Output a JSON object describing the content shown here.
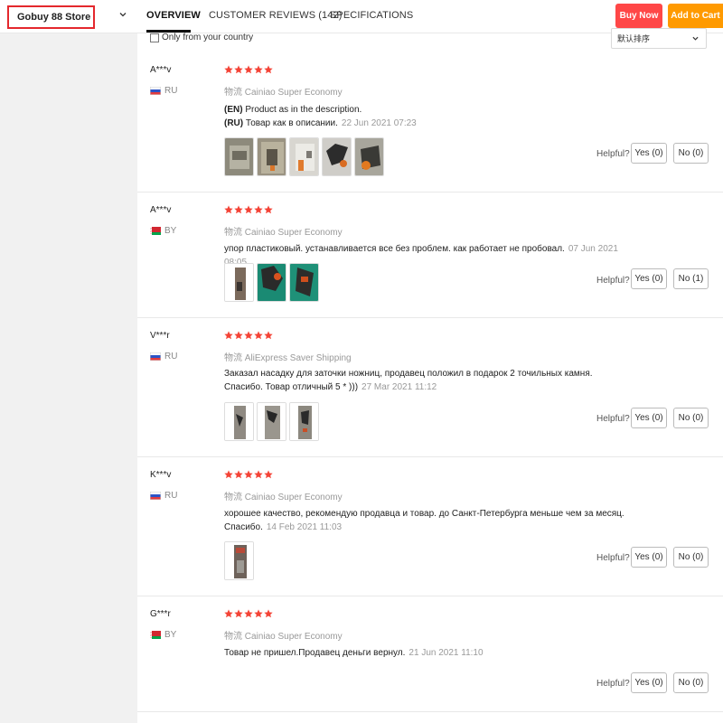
{
  "header": {
    "store_name": "Gobuy 88 Store",
    "tabs": [
      {
        "label": "OVERVIEW",
        "active": true
      },
      {
        "label": "CUSTOMER REVIEWS (142)",
        "active": false
      },
      {
        "label": "SPECIFICATIONS",
        "active": false
      }
    ],
    "buy_now_label": "Buy Now",
    "add_to_cart_label": "Add to Cart"
  },
  "filters": {
    "only_country_label": "Only from your country",
    "only_country_checked": false,
    "sort_value": "默认排序"
  },
  "helpful_label": "Helpful?",
  "reviews": [
    {
      "name": "A***v",
      "country": "RU",
      "flag": "russia-flag",
      "stars": 5,
      "shipping": "物流 Cainiao Super Economy",
      "text_en_prefix": "(EN)",
      "text_en": "Product as in the description.",
      "text_ru_prefix": "(RU)",
      "text_ru": "Товар как в описании.",
      "date": "22 Jun 2021 07:23",
      "photos": 5,
      "yes_label": "Yes (0)",
      "no_label": "No (0)"
    },
    {
      "name": "A***v",
      "country": "BY",
      "flag": "belarus-flag",
      "stars": 5,
      "shipping": "物流 Cainiao Super Economy",
      "text": "упор пластиковый. устанавливается все без проблем. как работает не пробовал.",
      "date": "07 Jun 2021 08:05",
      "photos": 3,
      "yes_label": "Yes (0)",
      "no_label": "No (1)"
    },
    {
      "name": "V***r",
      "country": "RU",
      "flag": "russia-flag",
      "stars": 5,
      "shipping": "物流 AliExpress Saver Shipping",
      "text": "Заказал насадку для заточки ножниц, продавец положил в подарок 2 точильных камня. Спасибо. Товар отличный 5 * )))",
      "date": "27 Mar 2021 11:12",
      "photos": 3,
      "yes_label": "Yes (0)",
      "no_label": "No (0)"
    },
    {
      "name": "K***v",
      "country": "RU",
      "flag": "russia-flag",
      "stars": 5,
      "shipping": "物流 Cainiao Super Economy",
      "text": "хорошее качество, рекомендую продавца и товар. до Санкт-Петербурга меньше чем за месяц. Спасибо.",
      "date": "14 Feb 2021 11:03",
      "photos": 1,
      "yes_label": "Yes (0)",
      "no_label": "No (0)"
    },
    {
      "name": "G***r",
      "country": "BY",
      "flag": "belarus-flag",
      "stars": 5,
      "shipping": "物流 Cainiao Super Economy",
      "text": "Товар не пришел.Продавец деньги вернул.",
      "date": "21 Jun 2021 11:10",
      "photos": 0,
      "yes_label": "Yes (0)",
      "no_label": "No (0)"
    }
  ],
  "colors": {
    "accent_red": "#ff4747",
    "accent_orange": "#ff9a00",
    "star_red": "#f44336",
    "store_border": "#e4282d"
  }
}
